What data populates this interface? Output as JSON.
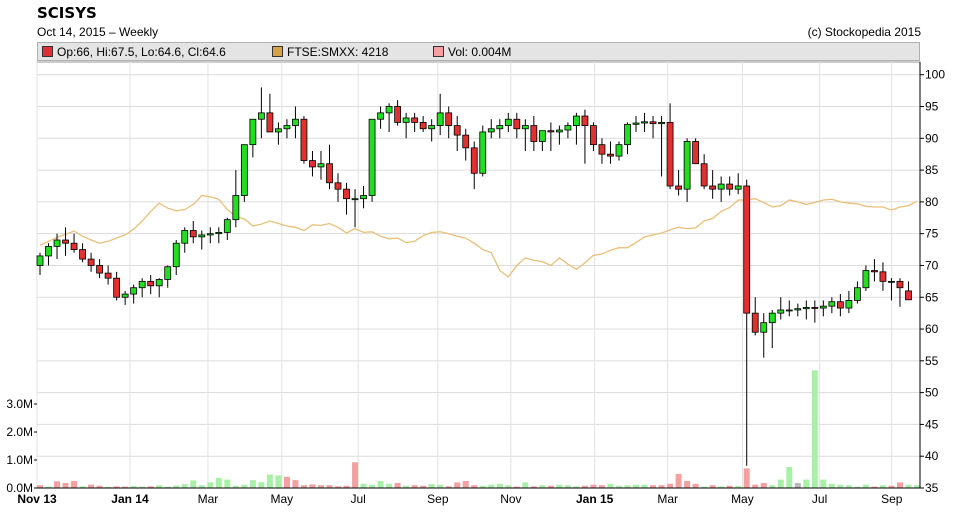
{
  "header": {
    "title": "SCISYS",
    "date_line": "Oct 14, 2015 – Weekly",
    "copyright": "(c) Stockopedia 2015"
  },
  "legend": [
    {
      "text": "Op:66, Hi:67.5, Lo:64.6, Cl:64.6",
      "color": "#e03030"
    },
    {
      "text": "FTSE:SMXX: 4218",
      "color": "#d4a24a"
    },
    {
      "text": "Vol: 0.004M",
      "color": "#f4a0a0"
    }
  ],
  "chart_data": {
    "type": "candlestick",
    "ylim": [
      35,
      102
    ],
    "y_ticks": [
      35,
      40,
      45,
      50,
      55,
      60,
      65,
      70,
      75,
      80,
      85,
      90,
      95,
      100
    ],
    "volume_ticks": [
      "0.0M",
      "1.0M",
      "2.0M",
      "3.0M"
    ],
    "volume_lim": [
      0,
      4.3
    ],
    "x_labels": [
      "Nov 13",
      "Jan 14",
      "Mar",
      "May",
      "Jul",
      "Sep",
      "Nov",
      "Jan 15",
      "Mar",
      "May",
      "Jul",
      "Sep"
    ],
    "x_label_bold": [
      true,
      true,
      false,
      false,
      false,
      false,
      false,
      true,
      false,
      false,
      false,
      false
    ],
    "x_label_pos": [
      36,
      148,
      242,
      331,
      423,
      519,
      607,
      708,
      796,
      886,
      979,
      1066
    ],
    "n_weeks": 104,
    "grid": true,
    "colors": {
      "up": "#22dd22",
      "down": "#e03030",
      "index": "#e8c07a",
      "vol_up": "#a8f0a8",
      "vol_down": "#f4a0a0",
      "vol_gray": "#b8b8b8"
    },
    "candles": [
      [
        70,
        72,
        68.5,
        71.5
      ],
      [
        71.5,
        73.5,
        70,
        73
      ],
      [
        73,
        75,
        71,
        74
      ],
      [
        74,
        76,
        71.5,
        73.5
      ],
      [
        73.5,
        75,
        72,
        72.5
      ],
      [
        72.5,
        73.5,
        70.5,
        71
      ],
      [
        71,
        72,
        69,
        70
      ],
      [
        70,
        71,
        68,
        68.8
      ],
      [
        68.8,
        70,
        67,
        68
      ],
      [
        68,
        69,
        64.5,
        65
      ],
      [
        65,
        66,
        63.8,
        65.5
      ],
      [
        65.5,
        67,
        64,
        66.5
      ],
      [
        66.5,
        68,
        65,
        67.5
      ],
      [
        67.5,
        68.5,
        65.5,
        66.8
      ],
      [
        66.8,
        68,
        65,
        67.8
      ],
      [
        67.8,
        70,
        66.5,
        69.8
      ],
      [
        69.8,
        74,
        68.5,
        73.5
      ],
      [
        73.5,
        76,
        72,
        75.5
      ],
      [
        75.5,
        77,
        73.5,
        74.5
      ],
      [
        74.5,
        75.5,
        72.5,
        74.8
      ],
      [
        74.8,
        76,
        73.5,
        75
      ],
      [
        75,
        76,
        73.5,
        75.2
      ],
      [
        75.2,
        77.5,
        74,
        77.2
      ],
      [
        77.2,
        85,
        76,
        81
      ],
      [
        81,
        88,
        80,
        89
      ],
      [
        89,
        92,
        87,
        93
      ],
      [
        93,
        98,
        90,
        94
      ],
      [
        94,
        97,
        91,
        91
      ],
      [
        91,
        92.5,
        89,
        91.5
      ],
      [
        91.5,
        93,
        90,
        92
      ],
      [
        92,
        95,
        90,
        93
      ],
      [
        93,
        93.5,
        86,
        86.5
      ],
      [
        86.5,
        88,
        84,
        85.5
      ],
      [
        85.5,
        88,
        83.5,
        86
      ],
      [
        86,
        89,
        82,
        83
      ],
      [
        83,
        84.5,
        80,
        82
      ],
      [
        82,
        83,
        78,
        80.5
      ],
      [
        80.5,
        82,
        76,
        80.5
      ],
      [
        80.5,
        82.5,
        79,
        81
      ],
      [
        81,
        93,
        80,
        93
      ],
      [
        93,
        95,
        91.5,
        94
      ],
      [
        94,
        95.5,
        91,
        95
      ],
      [
        95,
        96,
        92,
        92.5
      ],
      [
        92.5,
        94,
        90,
        93.2
      ],
      [
        93.2,
        94,
        91,
        92.5
      ],
      [
        92.5,
        93.5,
        91,
        91.5
      ],
      [
        91.5,
        93,
        89.5,
        92
      ],
      [
        92,
        97,
        90.5,
        94
      ],
      [
        94,
        95,
        90,
        92
      ],
      [
        92,
        93.5,
        88,
        90.5
      ],
      [
        90.5,
        91.5,
        86.5,
        88.5
      ],
      [
        88.5,
        89.5,
        82,
        84.5
      ],
      [
        84.5,
        92,
        84,
        91
      ],
      [
        91,
        93,
        90,
        91.5
      ],
      [
        91.5,
        93,
        90,
        92
      ],
      [
        92,
        94,
        91,
        93
      ],
      [
        93,
        94,
        90,
        91.5
      ],
      [
        91.5,
        93,
        88,
        92
      ],
      [
        92,
        93.5,
        88,
        89.5
      ],
      [
        89.5,
        91,
        88,
        91.2
      ],
      [
        91.2,
        92.5,
        88,
        91
      ],
      [
        91,
        92,
        89,
        91.3
      ],
      [
        91.3,
        92.5,
        90,
        92
      ],
      [
        92,
        94,
        89,
        93.5
      ],
      [
        93.5,
        94.5,
        86,
        92
      ],
      [
        92,
        92.5,
        88,
        89
      ],
      [
        89,
        90,
        86,
        87.5
      ],
      [
        87.5,
        89.5,
        86,
        87.2
      ],
      [
        87.2,
        89.5,
        86.5,
        89
      ],
      [
        89,
        92.5,
        87.5,
        92.2
      ],
      [
        92.2,
        93.5,
        91,
        92.4
      ],
      [
        92.4,
        94,
        91,
        92.6
      ],
      [
        92.6,
        93.5,
        90,
        92.3
      ],
      [
        92.3,
        93.5,
        84,
        92.5
      ],
      [
        92.5,
        95.5,
        82,
        82.5
      ],
      [
        82.5,
        85,
        81,
        82
      ],
      [
        82,
        90,
        80,
        89.5
      ],
      [
        89.5,
        90,
        86,
        86
      ],
      [
        86,
        87.5,
        82,
        82.5
      ],
      [
        82.5,
        85,
        80.5,
        82
      ],
      [
        82,
        84,
        80,
        82.8
      ],
      [
        82.8,
        84,
        81,
        82
      ],
      [
        82,
        84.5,
        81.2,
        82.5
      ],
      [
        82.5,
        83.5,
        38.5,
        62.5
      ],
      [
        62.5,
        65,
        59,
        59.5
      ],
      [
        59.5,
        62.5,
        55.5,
        61
      ],
      [
        61,
        63,
        57,
        62.5
      ],
      [
        62.5,
        65,
        61.5,
        63
      ],
      [
        63,
        64.5,
        62,
        63
      ],
      [
        63,
        64,
        62,
        63.2
      ],
      [
        63.2,
        64.5,
        61.5,
        63.4
      ],
      [
        63.4,
        64.5,
        61,
        63.3
      ],
      [
        63.3,
        64.5,
        62,
        63.6
      ],
      [
        63.6,
        65,
        62.5,
        64.3
      ],
      [
        64.3,
        65.5,
        62,
        63.3
      ],
      [
        63.3,
        66,
        62.5,
        64.5
      ],
      [
        64.5,
        67.5,
        64,
        66.5
      ],
      [
        66.5,
        70,
        66,
        69.2
      ],
      [
        69.2,
        71,
        67.5,
        69
      ],
      [
        69,
        70.5,
        66,
        67.5
      ],
      [
        67.5,
        68,
        64.5,
        67.5
      ],
      [
        67.5,
        68,
        63.5,
        66.5
      ],
      [
        66,
        67.5,
        64.6,
        64.6
      ]
    ],
    "index_line": [
      73.2,
      73.8,
      74.4,
      74.9,
      75.4,
      74.6,
      74.0,
      73.5,
      73.8,
      74.3,
      74.8,
      75.7,
      77.0,
      78.5,
      79.8,
      79.0,
      78.6,
      78.8,
      79.6,
      81.0,
      80.8,
      80.4,
      78.8,
      77.7,
      77.3,
      76.2,
      76.5,
      77.0,
      76.6,
      76.2,
      76.0,
      75.5,
      76.4,
      76.3,
      76.6,
      76.0,
      75.1,
      75.8,
      75.2,
      75.3,
      74.6,
      74.2,
      74.3,
      73.6,
      73.8,
      74.7,
      75.2,
      75.3,
      75.0,
      74.6,
      74.3,
      73.5,
      72.5,
      72.0,
      69.2,
      68.2,
      70.0,
      71.2,
      70.8,
      70.6,
      70.0,
      71.2,
      70.2,
      69.4,
      70.4,
      71.6,
      71.8,
      72.4,
      72.8,
      72.8,
      73.6,
      74.5,
      74.8,
      75.1,
      75.6,
      76.0,
      75.8,
      75.9,
      77.0,
      77.4,
      78.5,
      79.1,
      80.3,
      80.3,
      80.5,
      79.9,
      79.2,
      79.4,
      80.3,
      80.0,
      79.6,
      79.9,
      80.3,
      80.4,
      80.0,
      79.8,
      79.7,
      79.3,
      79.2,
      79.2,
      78.7,
      79.2,
      79.4,
      80.1
    ],
    "volume": [
      0.1,
      0.05,
      0.24,
      0.18,
      0.25,
      0.06,
      0.12,
      0.08,
      0.04,
      0.06,
      0.05,
      0.07,
      0.05,
      0.06,
      0.1,
      0.05,
      0.09,
      0.14,
      0.27,
      0.1,
      0.2,
      0.36,
      0.3,
      0.08,
      0.12,
      0.28,
      0.21,
      0.48,
      0.45,
      0.4,
      0.28,
      0.1,
      0.13,
      0.1,
      0.1,
      0.06,
      0.08,
      0.92,
      0.15,
      0.12,
      0.25,
      0.15,
      0.18,
      0.08,
      0.1,
      0.08,
      0.14,
      0.12,
      0.06,
      0.2,
      0.25,
      0.1,
      0.08,
      0.12,
      0.15,
      0.1,
      0.05,
      0.2,
      0.06,
      0.1,
      0.08,
      0.12,
      0.1,
      0.06,
      0.08,
      0.12,
      0.1,
      0.15,
      0.08,
      0.1,
      0.12,
      0.12,
      0.1,
      0.1,
      0.15,
      0.5,
      0.25,
      0.15,
      0.05,
      0.1,
      0.06,
      0.08,
      0.07,
      0.7,
      0.12,
      0.18,
      0.1,
      0.3,
      0.75,
      0.18,
      0.3,
      4.2,
      0.3,
      0.15,
      0.12,
      0.1,
      0.05,
      0.12,
      0.05,
      0.1,
      0.08,
      0.2,
      0.12,
      0.1
    ],
    "volume_color": [
      "d",
      "g",
      "d",
      "d",
      "d",
      "g",
      "d",
      "d",
      "g",
      "d",
      "d",
      "g",
      "g",
      "d",
      "g",
      "g",
      "g",
      "g",
      "g",
      "g",
      "g",
      "g",
      "g",
      "g",
      "g",
      "g",
      "g",
      "g",
      "g",
      "d",
      "d",
      "d",
      "d",
      "d",
      "d",
      "d",
      "d",
      "d",
      "g",
      "g",
      "g",
      "g",
      "d",
      "g",
      "d",
      "d",
      "g",
      "g",
      "d",
      "d",
      "d",
      "d",
      "g",
      "g",
      "g",
      "g",
      "d",
      "g",
      "d",
      "g",
      "d",
      "g",
      "g",
      "g",
      "d",
      "d",
      "d",
      "g",
      "g",
      "g",
      "g",
      "g",
      "d",
      "d",
      "d",
      "d",
      "d",
      "d",
      "g",
      "d",
      "g",
      "d",
      "g",
      "d",
      "d",
      "d",
      "g",
      "g",
      "g",
      "s",
      "g",
      "g",
      "g",
      "g",
      "g",
      "g",
      "g",
      "g",
      "d",
      "g",
      "d",
      "d"
    ]
  }
}
